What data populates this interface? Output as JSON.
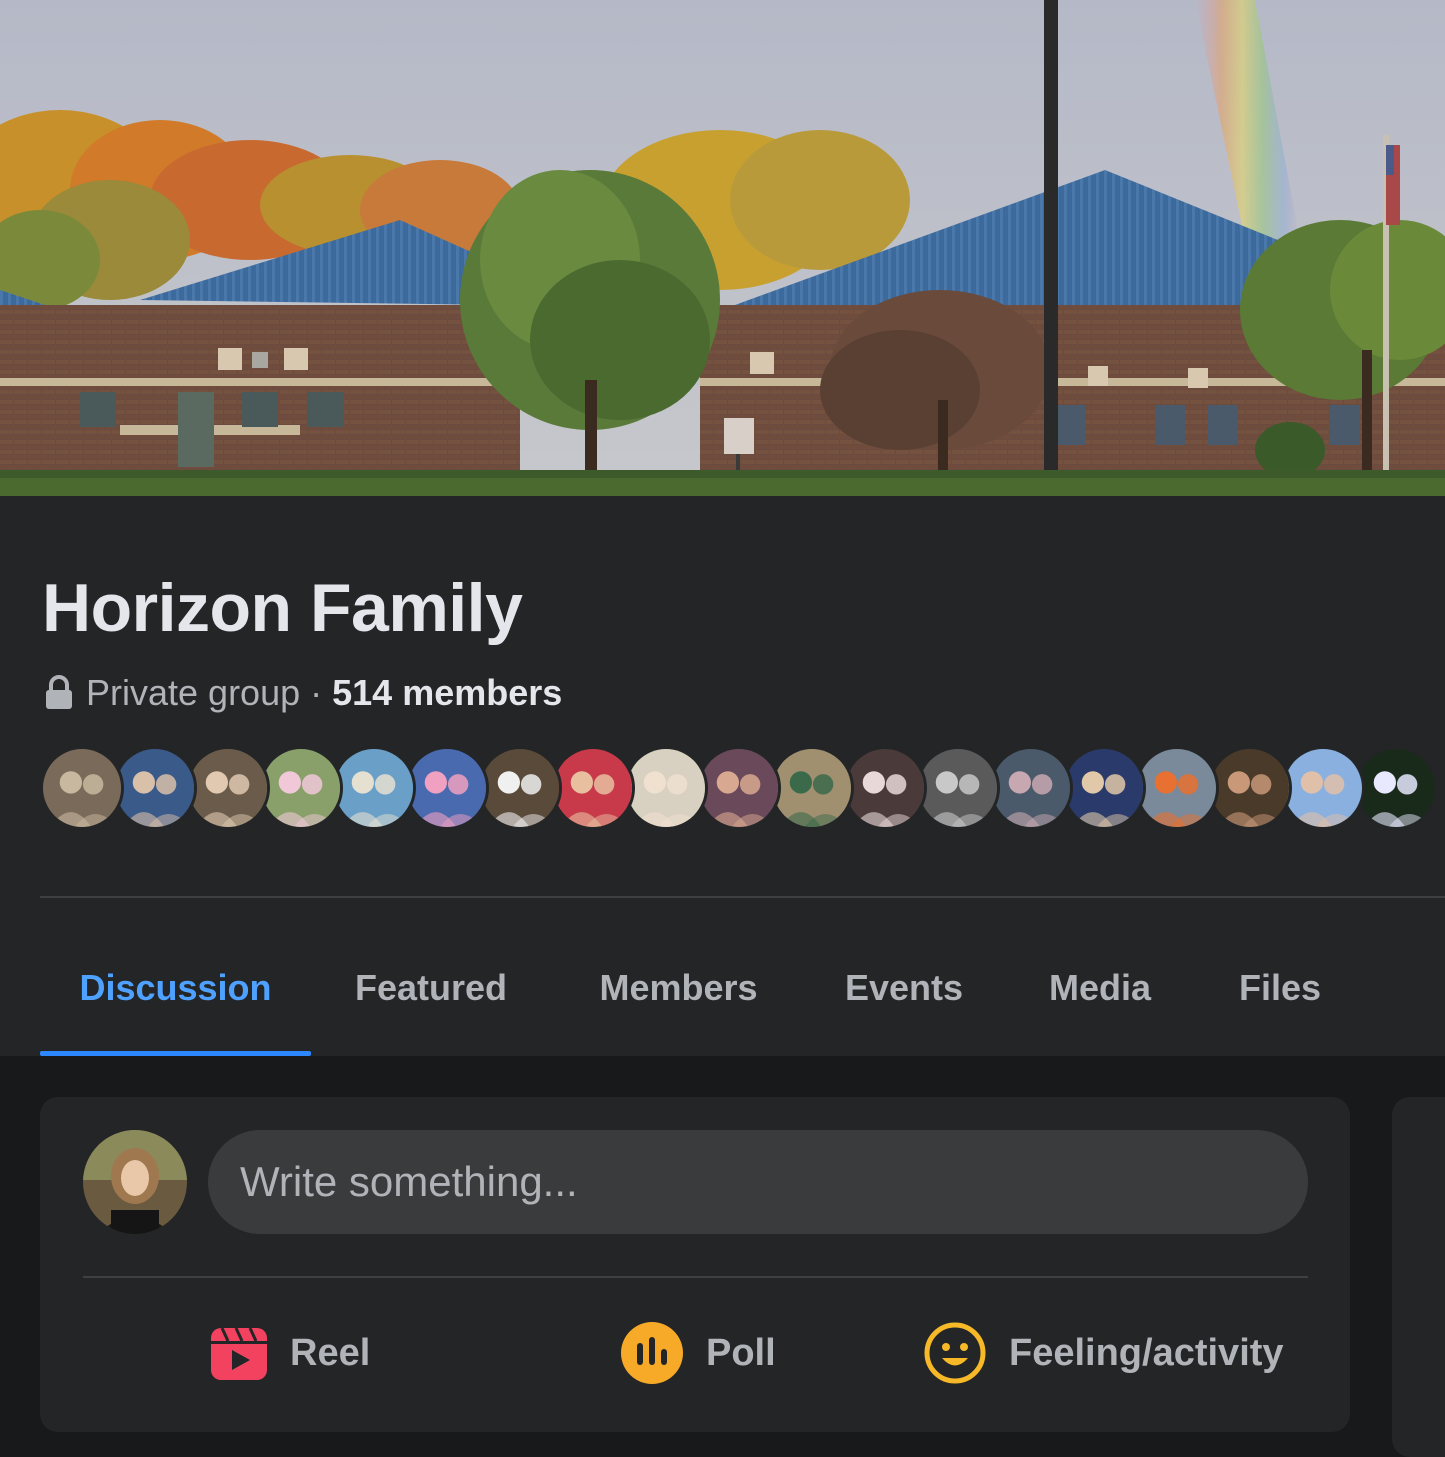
{
  "group": {
    "name": "Horizon Family",
    "privacy_label": "Private group",
    "separator": "·",
    "members_label": "514 members"
  },
  "member_avatars": [
    {
      "name": "member-avatar",
      "bg": "#7a6a5a",
      "fg": "#c8b8a0"
    },
    {
      "name": "member-avatar",
      "bg": "#3a5a8a",
      "fg": "#d9c0a8"
    },
    {
      "name": "member-avatar",
      "bg": "#6b5b4b",
      "fg": "#e0c9b0"
    },
    {
      "name": "member-avatar",
      "bg": "#8aa06a",
      "fg": "#f0c8d8"
    },
    {
      "name": "member-avatar",
      "bg": "#6aa0c8",
      "fg": "#e6e0d0"
    },
    {
      "name": "member-avatar",
      "bg": "#4a6ab0",
      "fg": "#f0a0c0"
    },
    {
      "name": "member-avatar",
      "bg": "#5a4a3a",
      "fg": "#f0f0f0"
    },
    {
      "name": "member-avatar",
      "bg": "#c83a4a",
      "fg": "#e8c0a0"
    },
    {
      "name": "member-avatar",
      "bg": "#d8d0c0",
      "fg": "#f0e0d0"
    },
    {
      "name": "member-avatar",
      "bg": "#6a4a5a",
      "fg": "#d8a890"
    },
    {
      "name": "member-avatar",
      "bg": "#a09070",
      "fg": "#3a6a4a"
    },
    {
      "name": "member-avatar",
      "bg": "#4a3a3a",
      "fg": "#e8d8d8"
    },
    {
      "name": "member-avatar",
      "bg": "#5a5a5a",
      "fg": "#c8c8c8"
    },
    {
      "name": "member-avatar",
      "bg": "#4a5a6a",
      "fg": "#c8a8b0"
    },
    {
      "name": "member-avatar",
      "bg": "#2a3a6a",
      "fg": "#e0c8a8"
    },
    {
      "name": "member-avatar",
      "bg": "#7a8a9a",
      "fg": "#e87030"
    },
    {
      "name": "member-avatar",
      "bg": "#4a3a2a",
      "fg": "#c89878"
    },
    {
      "name": "member-avatar",
      "bg": "#8ab0e0",
      "fg": "#e0c0a8"
    },
    {
      "name": "member-avatar",
      "bg": "#1a2a1a",
      "fg": "#e8e8ff"
    }
  ],
  "tabs": [
    {
      "label": "Discussion",
      "active": true
    },
    {
      "label": "Featured",
      "active": false
    },
    {
      "label": "Members",
      "active": false
    },
    {
      "label": "Events",
      "active": false
    },
    {
      "label": "Media",
      "active": false
    },
    {
      "label": "Files",
      "active": false
    }
  ],
  "composer": {
    "placeholder": "Write something...",
    "actions": [
      {
        "label": "Reel",
        "icon": "reel-icon",
        "color": "#f3425f"
      },
      {
        "label": "Poll",
        "icon": "poll-icon",
        "color": "#f7b928"
      },
      {
        "label": "Feeling/activity",
        "icon": "feeling-icon",
        "color": "#f7b928"
      }
    ]
  },
  "colors": {
    "accent": "#2d88ff",
    "active_tab_text": "#4ea1ff",
    "card": "#242526",
    "page": "#18191a"
  }
}
